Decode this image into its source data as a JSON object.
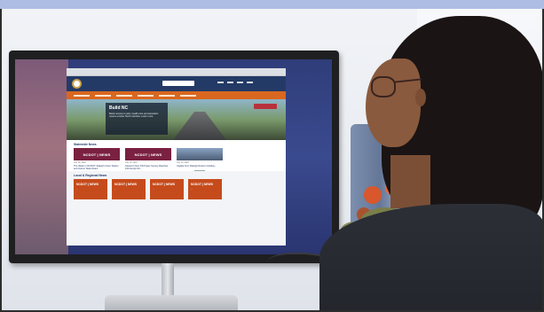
{
  "scene": {
    "colors": {
      "top_bar": "#aebde4",
      "site_header": "#233a66",
      "site_nav": "#d9671f",
      "news_badge": "#7a2040",
      "local_badge": "#c64b1c",
      "monitor_frame": "#1f1f22"
    }
  },
  "website": {
    "hero_title": "Build NC",
    "hero_text": "Better access to jobs, health care and education means a better North Carolina. Learn more",
    "statewide_news_title": "Statewide News",
    "news_cards": [
      {
        "badge": "NCDOT | NEWS",
        "date": "July 14, 2022",
        "text": "The Week in NCDOT: Raleigh Union Station and Interim State Road..."
      },
      {
        "badge": "NCDOT | NEWS",
        "date": "July 13, 2022",
        "text": "Season's Non-Toll Paper Survey Reaches 100 Family NC..."
      },
      {
        "badge": "",
        "date": "July 13, 2022",
        "text": "Update from Raleigh Road to Holiday..."
      }
    ],
    "local_news_title": "Local & Regional News",
    "local_cards": [
      {
        "badge": "NCDOT | NEWS",
        "text": "..."
      },
      {
        "badge": "NCDOT | NEWS",
        "text": "..."
      },
      {
        "badge": "NCDOT | NEWS",
        "text": "..."
      },
      {
        "badge": "NCDOT | NEWS",
        "text": "..."
      }
    ]
  }
}
